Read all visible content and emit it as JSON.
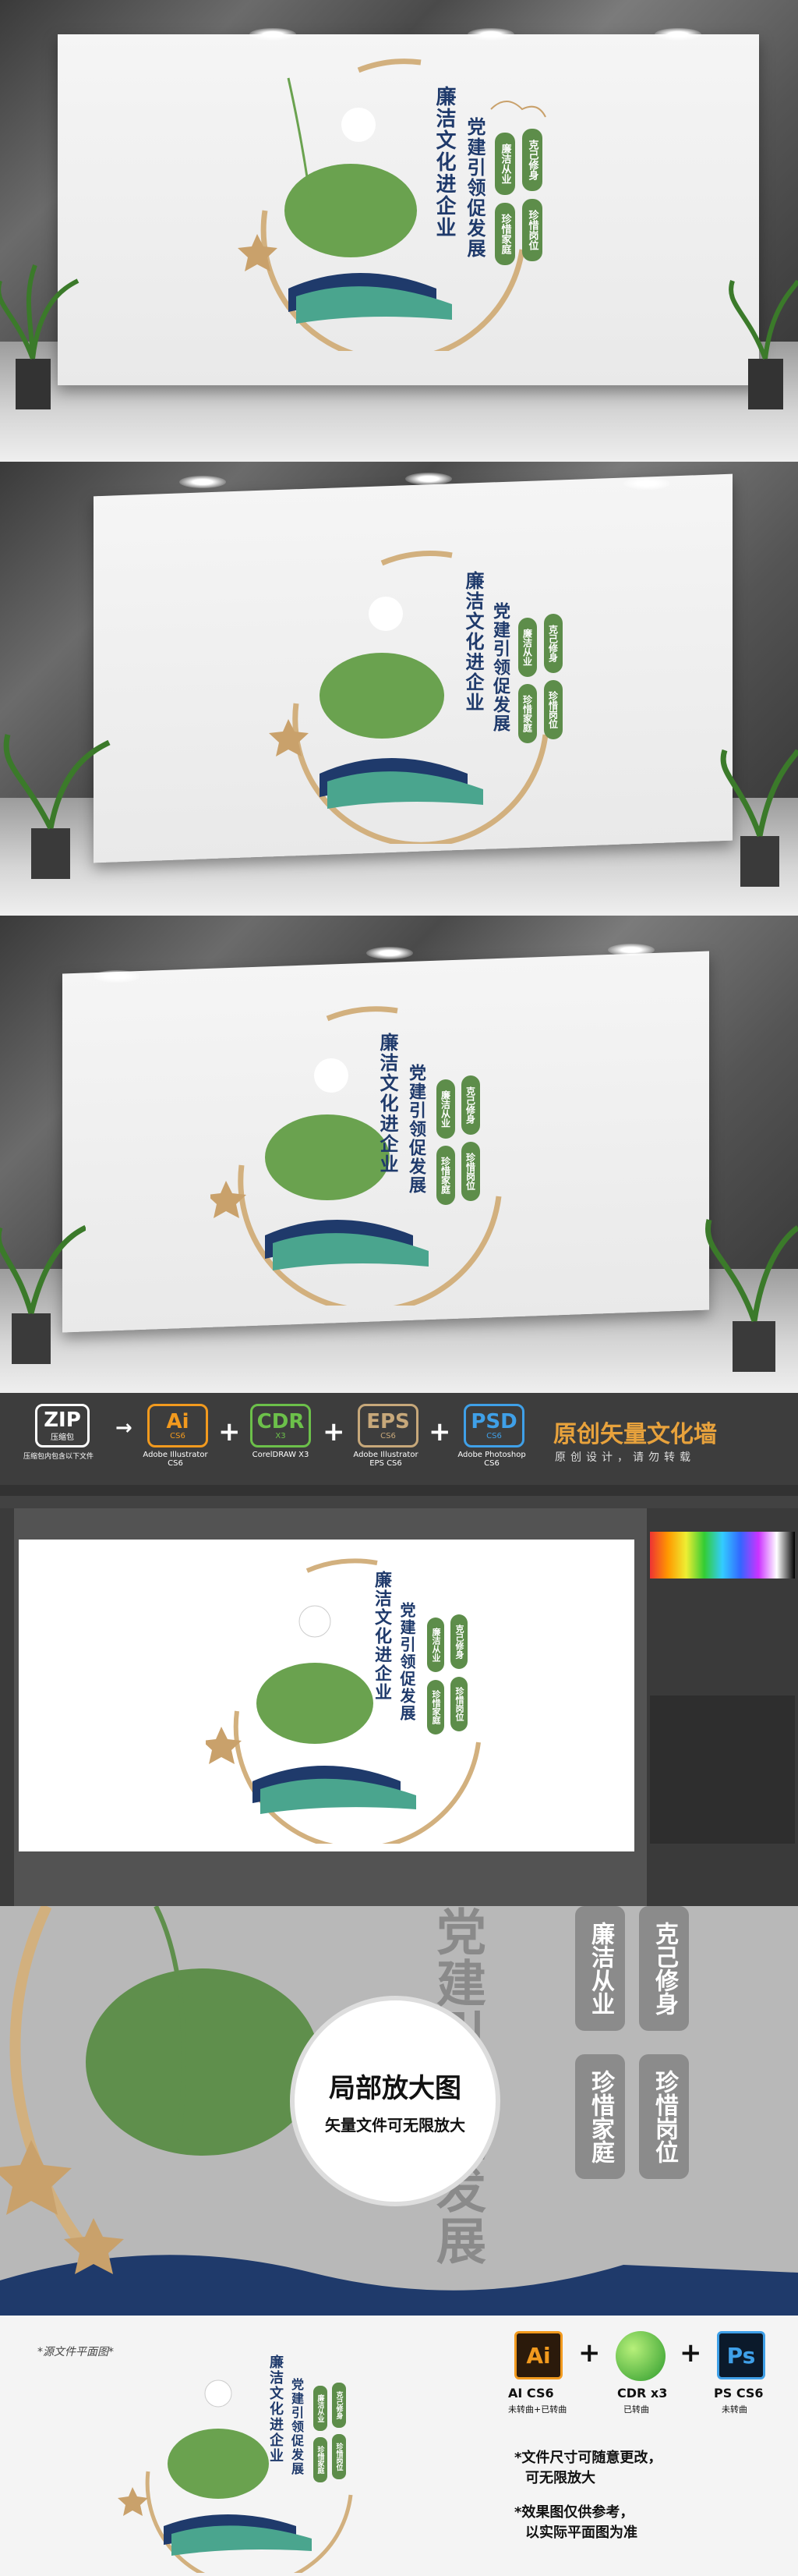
{
  "design": {
    "title_main": "廉洁文化进企业",
    "title_sub": "党建引领促发展",
    "pills": [
      "廉洁从业",
      "克己修身",
      "珍惜家庭",
      "珍惜岗位"
    ],
    "colors": {
      "navy": "#1f3a6b",
      "green": "#5d8d4a",
      "gold": "#d2b07e",
      "teal": "#4aa58e"
    }
  },
  "format_strip": {
    "zip": {
      "label": "ZIP",
      "caption": "压缩包",
      "note": "压缩包内包含以下文件"
    },
    "ai": {
      "label": "Ai",
      "version": "CS6",
      "caption": "Adobe Illustrator CS6",
      "color": "#f29a1e"
    },
    "cdr": {
      "label": "CDR",
      "version": "X3",
      "caption": "CorelDRAW X3",
      "color": "#6cc04a"
    },
    "eps": {
      "label": "EPS",
      "version": "CS6",
      "caption": "Adobe Illustrator EPS CS6",
      "color": "#c7a87a"
    },
    "psd": {
      "label": "PSD",
      "version": "CS6",
      "caption": "Adobe Photoshop CS6",
      "color": "#3fa0e8"
    },
    "title": "原创矢量文化墙",
    "subtitle": "原创设计，请勿转载"
  },
  "zoom": {
    "badge_title": "局部放大图",
    "badge_sub": "矢量文件可无限放大"
  },
  "bottom": {
    "source_label": "*源文件平面图*",
    "ai_label": "AI CS6",
    "ai_note": "未转曲+已转曲",
    "cdr_label": "CDR x3",
    "cdr_note": "已转曲",
    "ps_label": "PS CS6",
    "ps_note": "未转曲",
    "note1_line1": "*文件尺寸可随意更改，",
    "note1_line2": "可无限放大",
    "note2_line1": "*效果图仅供参考，",
    "note2_line2": "以实际平面图为准",
    "icons": {
      "ai": "Ai",
      "ps": "Ps"
    }
  }
}
